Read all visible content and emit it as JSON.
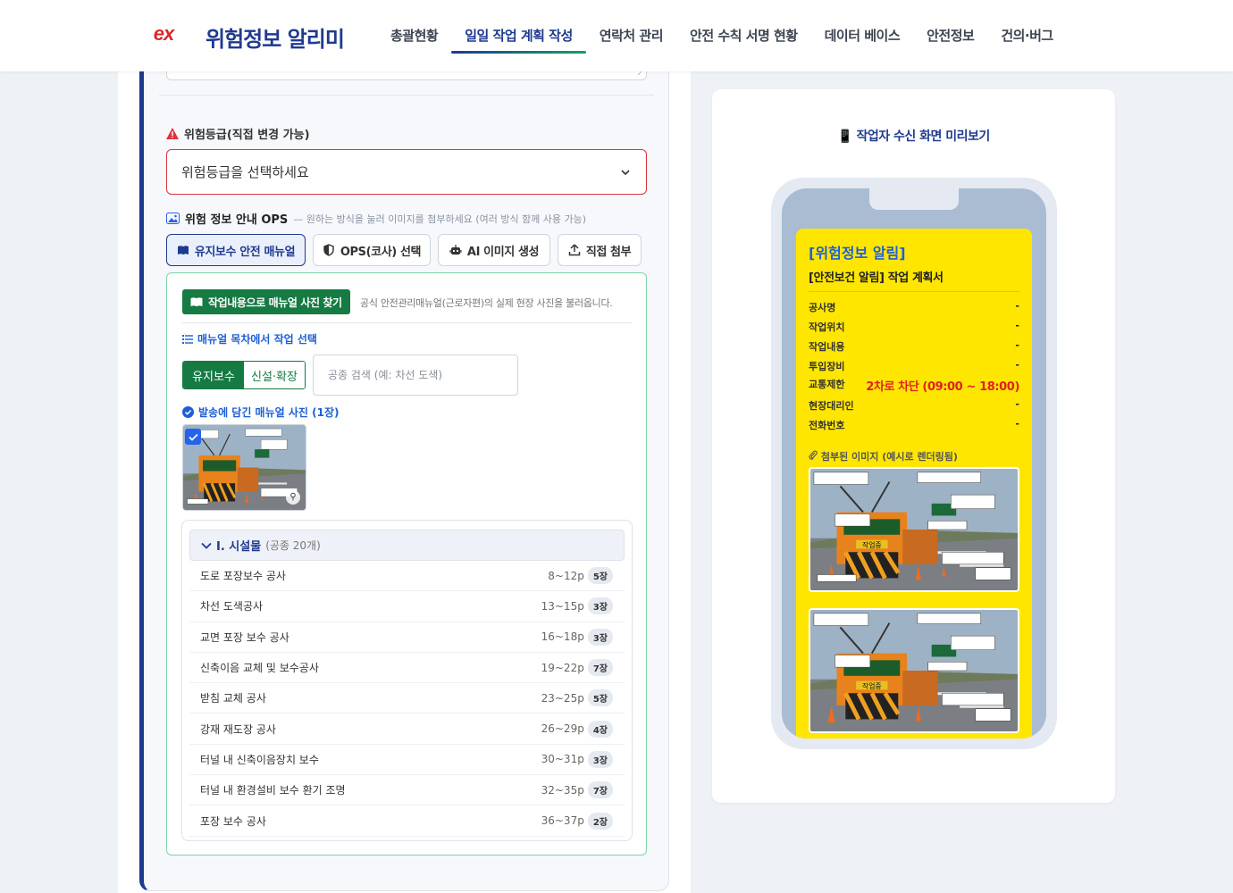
{
  "header": {
    "logo_mark": "ex",
    "logo_text": "위험정보 알리미",
    "nav": [
      {
        "label": "총괄현황",
        "active": false
      },
      {
        "label": "일일 작업 계획 작성",
        "active": true
      },
      {
        "label": "연락처 관리",
        "active": false
      },
      {
        "label": "안전 수칙 서명 현황",
        "active": false
      },
      {
        "label": "데이터 베이스",
        "active": false
      },
      {
        "label": "안전정보",
        "active": false
      },
      {
        "label": "건의·버그",
        "active": false
      }
    ]
  },
  "form": {
    "risk_label": "위험등급(직접 변경 가능)",
    "risk_select_placeholder": "위험등급을 선택하세요",
    "ops_title": "위험 정보 안내 OPS",
    "ops_hint": "— 원하는 방식을 눌러 이미지를 첨부하세요 (여러 방식 함께 사용 가능)",
    "method_buttons": [
      {
        "label": "유지보수 안전 매뉴얼",
        "icon": "book-icon",
        "active": true
      },
      {
        "label": "OPS(코사) 선택",
        "icon": "shield-icon",
        "active": false
      },
      {
        "label": "AI 이미지 생성",
        "icon": "robot-icon",
        "active": false
      },
      {
        "label": "직접 첨부",
        "icon": "upload-icon",
        "active": false
      }
    ],
    "manual": {
      "find_button": "작업내용으로 매뉴얼 사진 찾기",
      "find_desc": "공식 안전관리매뉴얼(근로자편)의 실제 현장 사진을 불러옵니다.",
      "toc_title": "매뉴얼 목차에서 작업 선택",
      "segments": [
        "유지보수",
        "신설·확장"
      ],
      "search_placeholder": "공종 검색 (예: 차선 도색)",
      "sent_title": "발송에 담긴 매뉴얼 사진 (1장)",
      "group": {
        "title": "I. 시설물",
        "count": "(공종 20개)"
      },
      "items": [
        {
          "name": "도로 포장보수 공사",
          "pages": "8~12p",
          "count": "5장"
        },
        {
          "name": "차선 도색공사",
          "pages": "13~15p",
          "count": "3장"
        },
        {
          "name": "교면 포장 보수 공사",
          "pages": "16~18p",
          "count": "3장"
        },
        {
          "name": "신축이음 교체 및 보수공사",
          "pages": "19~22p",
          "count": "7장"
        },
        {
          "name": "받침 교체 공사",
          "pages": "23~25p",
          "count": "5장"
        },
        {
          "name": "강재 재도장 공사",
          "pages": "26~29p",
          "count": "4장"
        },
        {
          "name": "터널 내 신축이음장치 보수",
          "pages": "30~31p",
          "count": "3장"
        },
        {
          "name": "터널 내 환경설비 보수 환기 조명",
          "pages": "32~35p",
          "count": "7장"
        },
        {
          "name": "포장 보수 공사",
          "pages": "36~37p",
          "count": "2장"
        }
      ]
    }
  },
  "preview": {
    "title": "📱 작업자 수신 화면 미리보기",
    "msg_title": "[위험정보 알림]",
    "msg_subtitle": "[안전보건 알림] 작업 계획서",
    "fields": [
      {
        "k": "공사명",
        "v": "-"
      },
      {
        "k": "작업위치",
        "v": "-"
      },
      {
        "k": "작업내용",
        "v": "-"
      },
      {
        "k": "투입장비",
        "v": "-"
      },
      {
        "k": "교통제한",
        "v": "2차로 차단 (09:00 ~ 18:00)"
      },
      {
        "k": "현장대리인",
        "v": "-"
      },
      {
        "k": "전화번호",
        "v": "-"
      }
    ],
    "attach_title": "첨부된 이미지 (예시로 렌더링됨)",
    "scene_sign": "작업중"
  },
  "colors": {
    "brand": "#1f3a8f",
    "accent_green": "#167a43",
    "danger": "#d9363e",
    "preview_bg": "#ffe600"
  }
}
